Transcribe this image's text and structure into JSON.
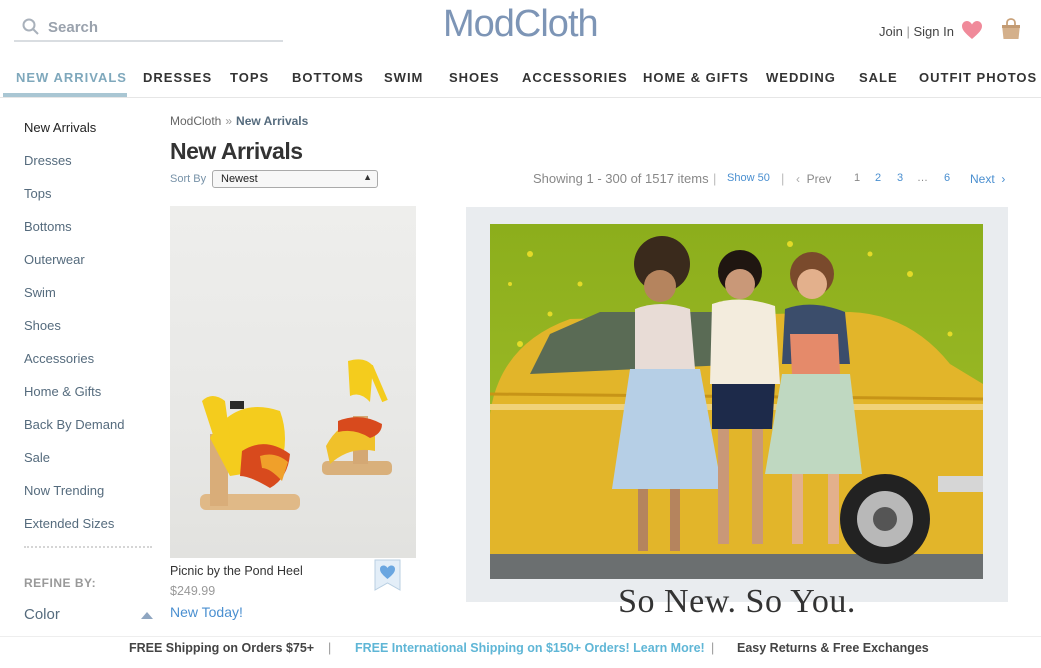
{
  "header": {
    "search_placeholder": "Search",
    "logo": "ModCloth",
    "join": "Join",
    "divider": "|",
    "sign_in": "Sign In"
  },
  "nav": {
    "items": [
      "NEW ARRIVALS",
      "DRESSES",
      "TOPS",
      "BOTTOMS",
      "SWIM",
      "SHOES",
      "ACCESSORIES",
      "HOME & GIFTS",
      "WEDDING",
      "SALE",
      "OUTFIT PHOTOS"
    ],
    "active": "NEW ARRIVALS"
  },
  "sidebar": {
    "items": [
      "New Arrivals",
      "Dresses",
      "Tops",
      "Bottoms",
      "Outerwear",
      "Swim",
      "Shoes",
      "Accessories",
      "Home & Gifts",
      "Back By Demand",
      "Sale",
      "Now Trending",
      "Extended Sizes"
    ],
    "refine_label": "REFINE BY:",
    "color_filter": "Color"
  },
  "breadcrumb": {
    "root": "ModCloth",
    "separator": "»",
    "current": "New Arrivals"
  },
  "page_title": "New Arrivals",
  "sort": {
    "label": "Sort By",
    "value": "Newest"
  },
  "pagination": {
    "showing": "Showing 1 - 300 of 1517 items",
    "show_50": "Show 50",
    "prev": "Prev",
    "pages": [
      "1",
      "2",
      "3",
      "…",
      "6"
    ],
    "current_page": "1",
    "next": "Next"
  },
  "product": {
    "name": "Picnic by the Pond Heel",
    "price": "$249.99",
    "badge": "New Today!"
  },
  "promo": {
    "caption": "So New. So You."
  },
  "footer": {
    "shipping": "FREE Shipping on Orders $75+",
    "international": "FREE International Shipping on $150+ Orders! Learn More!",
    "returns": "Easy Returns & Free Exchanges",
    "divider": "|"
  },
  "colors": {
    "brand": "#7d95b6",
    "active_nav": "#7fa8bc",
    "link": "#4a8fd0",
    "promo_link": "#5fb6d6",
    "heart": "#f08a9a"
  }
}
